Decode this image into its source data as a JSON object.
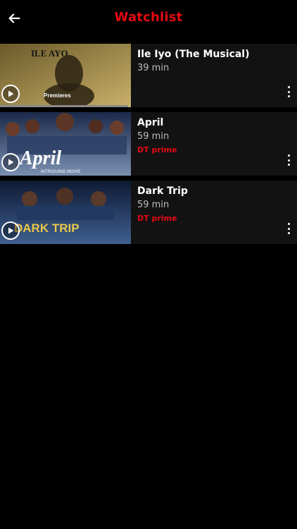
{
  "header": {
    "title": "Watchlist",
    "title_color": "#e50914"
  },
  "items": [
    {
      "title": "Ile Iyo (The Musical)",
      "duration": "39 min",
      "badge": "",
      "progress_fraction": 0.98,
      "poster_text": "ILE AYO",
      "poster_subtext": "Premieres",
      "poster_colors": [
        "#6b5a2a",
        "#c9b06a"
      ]
    },
    {
      "title": "April",
      "duration": "59 min",
      "badge": "DT prime",
      "progress_fraction": 0,
      "poster_text": "April",
      "poster_subtext": "INTRIGUING MOVIE",
      "poster_colors": [
        "#1b2a4a",
        "#7a8fb0"
      ]
    },
    {
      "title": "Dark Trip",
      "duration": "59 min",
      "badge": "DT prime",
      "progress_fraction": 0,
      "poster_text": "DARK TRIP",
      "poster_subtext": "",
      "poster_colors": [
        "#0e1a33",
        "#3f5f8f"
      ]
    }
  ]
}
